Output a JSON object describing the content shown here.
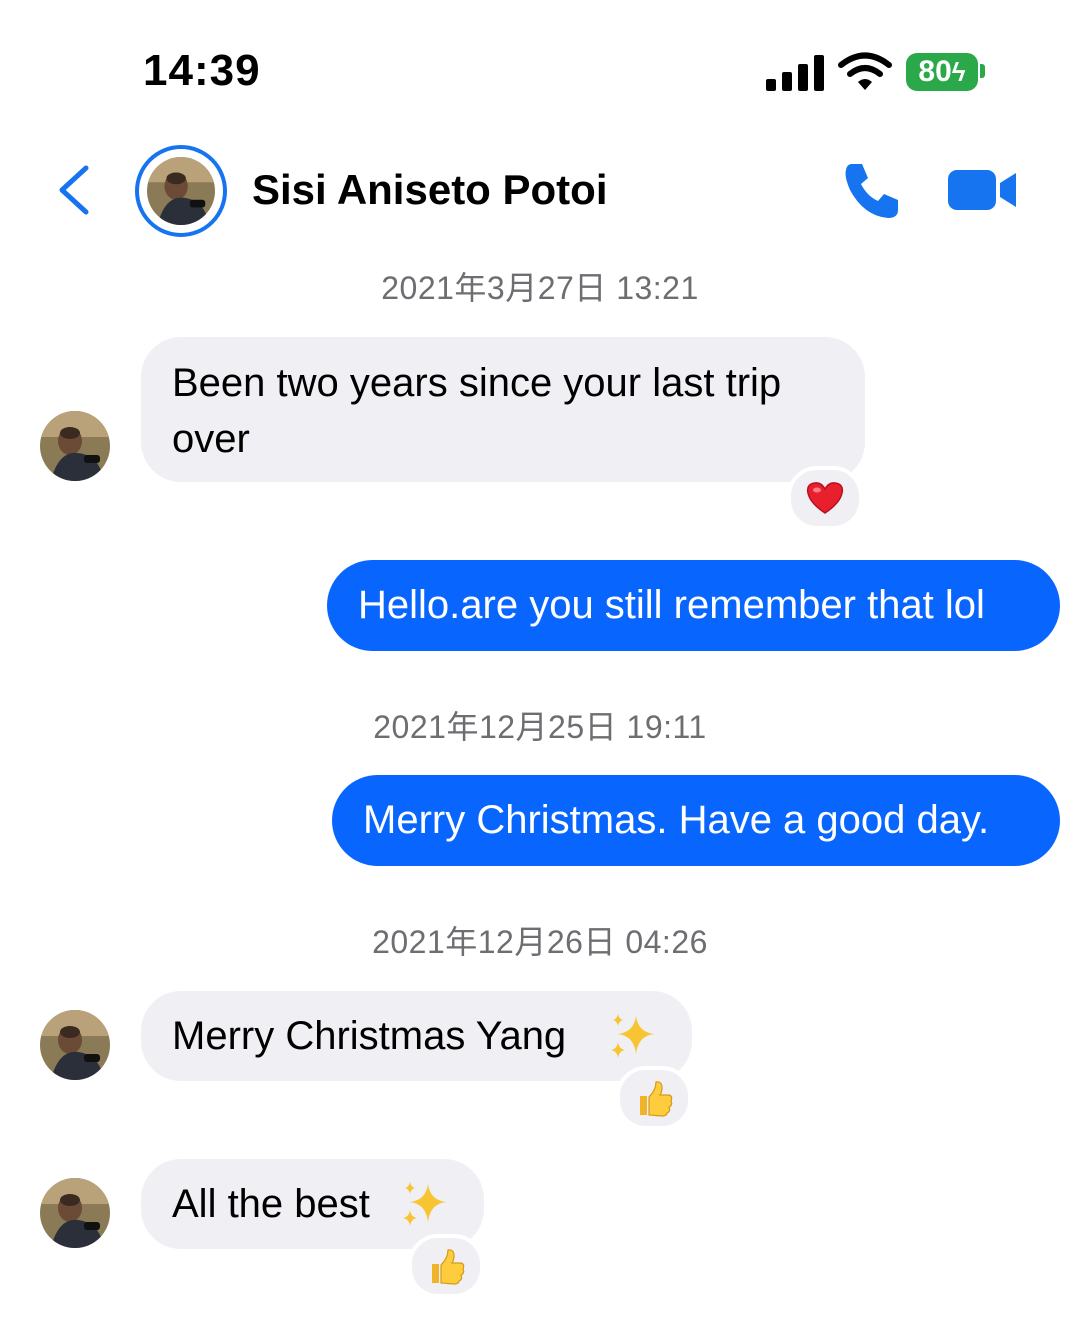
{
  "status_bar": {
    "time": "14:39",
    "battery": "80",
    "battery_color": "#2aa84a"
  },
  "header": {
    "contact_name": "Sisi Aniseto Potoi",
    "back_icon": "chevron-left-icon",
    "call_icon": "phone-icon",
    "video_icon": "video-camera-icon",
    "accent_color": "#1674f0"
  },
  "messages": [
    {
      "type": "timestamp",
      "text": "2021年3月27日 13:21"
    },
    {
      "type": "incoming",
      "line1": "Been two years since your last trip",
      "line2": "over",
      "reaction": "heart"
    },
    {
      "type": "outgoing",
      "text": "Hello.are you still remember that lol"
    },
    {
      "type": "timestamp",
      "text": "2021年12月25日 19:11"
    },
    {
      "type": "outgoing",
      "text": "Merry Christmas. Have a good day."
    },
    {
      "type": "timestamp",
      "text": "2021年12月26日 04:26"
    },
    {
      "type": "incoming",
      "text": "Merry Christmas Yang",
      "emoji": "sparkles",
      "reaction": "thumbs-up"
    },
    {
      "type": "incoming",
      "text": "All the best",
      "emoji": "sparkles",
      "reaction": "thumbs-up"
    }
  ],
  "colors": {
    "outgoing_bubble": "#0866ff",
    "incoming_bubble": "#efeff4",
    "timestamp_text": "#6d6d72"
  }
}
